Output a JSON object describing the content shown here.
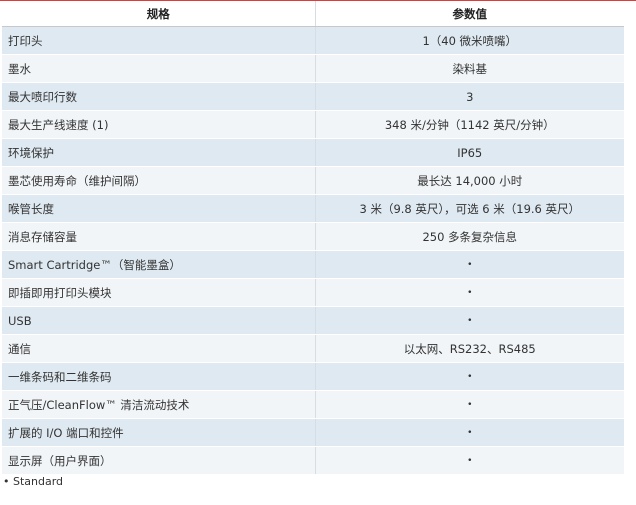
{
  "table": {
    "headers": [
      "规格",
      "参数值"
    ],
    "rows": [
      {
        "label": "打印头",
        "value": "1（40 微米喷嘴）"
      },
      {
        "label": "墨水",
        "value": "染料基"
      },
      {
        "label": "最大喷印行数",
        "value": "3"
      },
      {
        "label": "最大生产线速度 (1)",
        "value": "348 米/分钟（1142 英尺/分钟）"
      },
      {
        "label": "环境保护",
        "value": "IP65"
      },
      {
        "label": "墨芯使用寿命（维护间隔）",
        "value": "最长达 14,000 小时"
      },
      {
        "label": "喉管长度",
        "value": "3 米（9.8 英尺），可选 6 米（19.6 英尺）"
      },
      {
        "label": "消息存储容量",
        "value": "250 多条复杂信息"
      },
      {
        "label": "Smart Cartridge™（智能墨盒）",
        "value": "•"
      },
      {
        "label": "即插即用打印头模块",
        "value": "•"
      },
      {
        "label": "USB",
        "value": "•"
      },
      {
        "label": "通信",
        "value": "以太网、RS232、RS485"
      },
      {
        "label": "一维条码和二维条码",
        "value": "•"
      },
      {
        "label": "正气压/CleanFlow™ 清洁流动技术",
        "value": "•"
      },
      {
        "label": "扩展的 I/O 端口和控件",
        "value": "•"
      },
      {
        "label": "显示屏（用户界面）",
        "value": "•"
      }
    ]
  },
  "footnote": "• Standard",
  "colors": {
    "header_rule": "#e03a3a",
    "row_dark": "#dfe9f1",
    "row_light": "#f1f5f8"
  }
}
